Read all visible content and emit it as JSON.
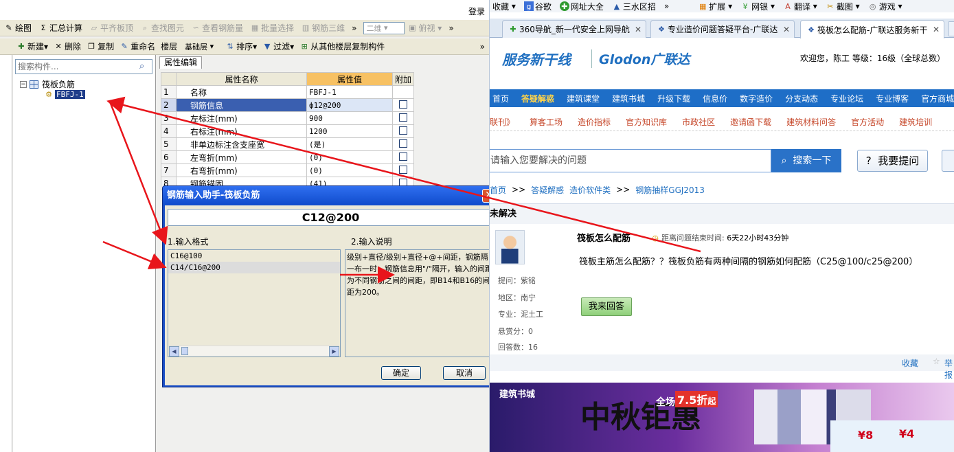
{
  "app": {
    "login": "登录",
    "toolbar1": [
      {
        "icon": "draw-icon",
        "glyph": "✎",
        "label": "绘图",
        "disabled": false
      },
      {
        "icon": "sum-icon",
        "glyph": "Σ",
        "label": "汇总计算",
        "disabled": false
      },
      {
        "icon": "flat-slab-icon",
        "glyph": "▱",
        "label": "平齐板顶",
        "disabled": true
      },
      {
        "icon": "find-element-icon",
        "glyph": "⌕",
        "label": "查找图元",
        "disabled": true
      },
      {
        "icon": "rebar-quantity-icon",
        "glyph": "∽",
        "label": "查看钢筋量",
        "disabled": true
      },
      {
        "icon": "batch-select-icon",
        "glyph": "▦",
        "label": "批量选择",
        "disabled": true
      },
      {
        "icon": "rebar-3d-icon",
        "glyph": "▥",
        "label": "钢筋三维",
        "disabled": true
      }
    ],
    "view_mode": "二维",
    "view_angle": "俯视",
    "toolbar2": {
      "new": "新建",
      "delete": "删除",
      "copy": "复制",
      "rename": "重命名",
      "floor_label": "楼层",
      "floor_value": "基础层",
      "sort": "排序",
      "filter": "过滤",
      "copy_from_floor": "从其他楼层复制构件"
    },
    "search_placeholder": "搜索构件...",
    "tree": {
      "root": "筏板负筋",
      "child": "FBFJ-1"
    },
    "prop_tab": "属性编辑",
    "grid_headers": [
      "属性名称",
      "属性值",
      "附加"
    ],
    "grid_rows": [
      {
        "n": "1",
        "name": "名称",
        "value": "FBFJ-1",
        "check": false
      },
      {
        "n": "2",
        "name": "钢筋信息",
        "value": "ф12@200",
        "check": true
      },
      {
        "n": "3",
        "name": "左标注(mm)",
        "value": "900",
        "check": true
      },
      {
        "n": "4",
        "name": "右标注(mm)",
        "value": "1200",
        "check": true
      },
      {
        "n": "5",
        "name": "非单边标注含支座宽",
        "value": "(是)",
        "check": true
      },
      {
        "n": "6",
        "name": "左弯折(mm)",
        "value": "(0)",
        "check": true
      },
      {
        "n": "7",
        "name": "右弯折(mm)",
        "value": "(0)",
        "check": true
      },
      {
        "n": "8",
        "name": "钢筋锚固",
        "value": "(41)",
        "check": true
      }
    ]
  },
  "dialog": {
    "title": "钢筋输入助手-筏板负筋",
    "value": "C12@200",
    "format_label": "1.输入格式",
    "desc_label": "2.输入说明",
    "formats": [
      "C16@100",
      "C14/C16@200"
    ],
    "description": "级别+直径/级别+直径+@+间距，钢筋隔一布一时，钢筋信息用\"/\"隔开，输入的间距为不同钢筋之间的间距，即B14和B16的间距为200。",
    "ok": "确定",
    "cancel": "取消"
  },
  "browser": {
    "bookmarks": [
      {
        "icon": "bookmark-icon",
        "glyph": "★",
        "label": "收藏"
      },
      {
        "icon": "google-icon",
        "glyph": "g",
        "label": "谷歌"
      },
      {
        "icon": "web-nav-icon",
        "glyph": "✚",
        "label": "网址大全"
      },
      {
        "icon": "sanshui-icon",
        "glyph": "▲",
        "label": "三水区招"
      },
      {
        "icon": "more-icon",
        "glyph": "»",
        "label": ""
      },
      {
        "icon": "extensions-icon",
        "glyph": "▦",
        "label": "扩展"
      },
      {
        "icon": "netbank-icon",
        "glyph": "¥",
        "label": "网银"
      },
      {
        "icon": "translate-icon",
        "glyph": "A",
        "label": "翻译"
      },
      {
        "icon": "screenshot-icon",
        "glyph": "✂",
        "label": "截图"
      },
      {
        "icon": "games-icon",
        "glyph": "◎",
        "label": "游戏"
      }
    ],
    "tabs": [
      {
        "label": "360导航_新一代安全上网导航",
        "active": false
      },
      {
        "label": "专业造价问题答疑平台-广联达",
        "active": false
      },
      {
        "label": "筏板怎么配筋-广联达服务新干",
        "active": true
      }
    ],
    "logo_cn": "服务新干线",
    "logo_en": "Glodon广联达",
    "welcome": "欢迎您，陈工    等级：16级（全球总数）",
    "nav1": [
      "首页",
      "答疑解惑",
      "建筑课堂",
      "建筑书城",
      "升级下载",
      "信息价",
      "数字造价",
      "分支动态",
      "专业论坛",
      "专业博客",
      "官方商城"
    ],
    "nav2": [
      "联刊》",
      "算客工场",
      "造价指标",
      "官方知识库",
      "市政社区",
      "邀请函下载",
      "建筑材料问答",
      "官方活动",
      "建筑培训"
    ],
    "search_placeholder": "请输入您要解决的问题",
    "search_btn": "搜索一下",
    "ask_btn": "我要提问",
    "breadcrumb": [
      "首页",
      ">>",
      "答疑解惑",
      "造价软件类",
      ">>",
      "钢筋抽样GGJ2013"
    ],
    "section": "未解决",
    "q_title": "筏板怎么配筋",
    "q_time_label": "距离问题结束时间:",
    "q_time": "6天22小时43分钟",
    "q_body": "筏板主筋怎么配筋？？筏板负筋有两种间隔的钢筋如何配筋（C25@100/c25@200）",
    "asker": "紫铭",
    "meta": [
      "提问：紫铭",
      "地区：南宁",
      "专业：泥土工",
      "悬赏分：0",
      "回答数：16"
    ],
    "answer_btn": "我来回答",
    "favorite": "收藏",
    "report": "举报",
    "banner_tag": "建筑书城",
    "banner_big": "中秋钜惠",
    "banner_sale": "全场",
    "banner_discount": "7.5折",
    "banner_from": "起",
    "coupons": [
      "¥8",
      "¥4"
    ]
  },
  "colors": {
    "accent": "#1e6ec7",
    "annotation": "#e8151b",
    "dialog_title": "#1a4fc5"
  }
}
